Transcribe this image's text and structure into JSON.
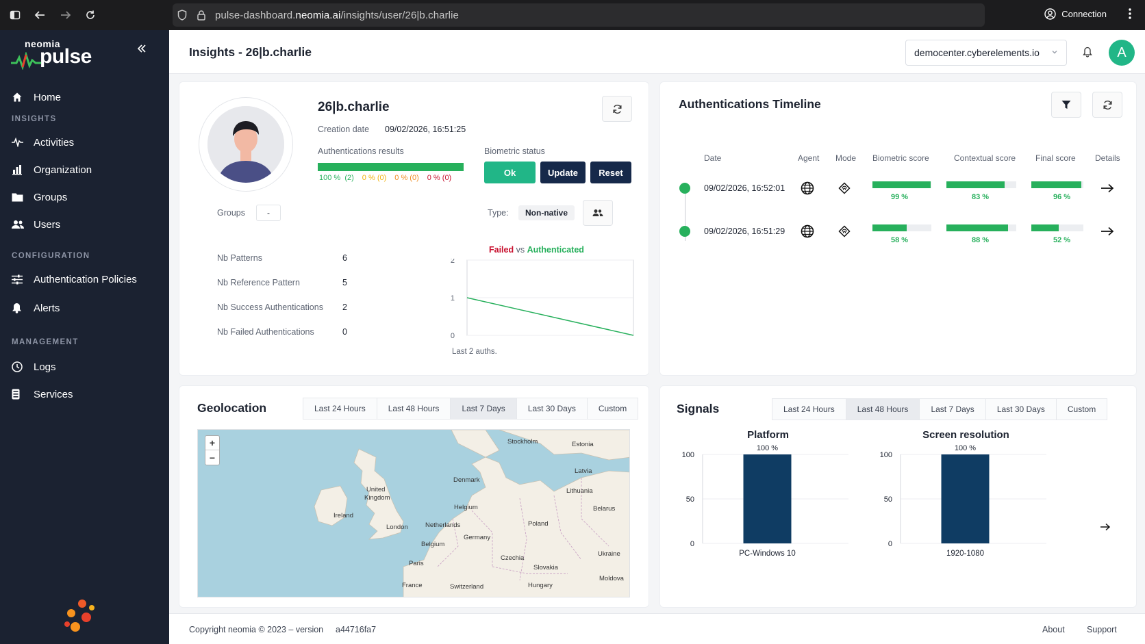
{
  "browser": {
    "url_prefix": "pulse-dashboard.",
    "url_domain": "neomia.ai",
    "url_path": "/insights/user/26|b.charlie",
    "connection_label": "Connection"
  },
  "sidebar": {
    "logo_top": "neomia",
    "logo_main": "pulse",
    "home": "Home",
    "sections": {
      "insights": "INSIGHTS",
      "configuration": "CONFIGURATION",
      "management": "MANAGEMENT"
    },
    "items": {
      "activities": "Activities",
      "organization": "Organization",
      "groups": "Groups",
      "users": "Users",
      "auth_policies": "Authentication Policies",
      "alerts": "Alerts",
      "logs": "Logs",
      "services": "Services"
    }
  },
  "header": {
    "title": "Insights - 26|b.charlie",
    "tenant": "democenter.cyberelements.io",
    "avatar_letter": "A"
  },
  "profile": {
    "name": "26|b.charlie",
    "creation_label": "Creation date",
    "creation_value": "09/02/2026, 16:51:25",
    "auth_results_label": "Authentications results",
    "legend": {
      "success": "100 %",
      "success_count": "(2)",
      "warn1": "0 %",
      "warn1_count": "(0)",
      "warn2": "0 %",
      "warn2_count": "(0)",
      "failed": "0 %",
      "failed_count": "(0)"
    },
    "success_ratio": 1.0,
    "biometric_label": "Biometric status",
    "btn_ok": "Ok",
    "btn_update": "Update",
    "btn_reset": "Reset",
    "groups_label": "Groups",
    "groups_value": "-",
    "type_label": "Type:",
    "type_value": "Non-native",
    "stats": [
      {
        "label": "Nb Patterns",
        "value": "6"
      },
      {
        "label": "Nb Reference Pattern",
        "value": "5"
      },
      {
        "label": "Nb Success Authentications",
        "value": "2"
      },
      {
        "label": "Nb Failed Authentications",
        "value": "0"
      }
    ],
    "chart_title_failed": "Failed",
    "chart_title_vs": " vs ",
    "chart_title_auth": "Authenticated",
    "chart_xlabel": "Last 2 auths.",
    "chart_yticks": [
      "2",
      "1",
      "0"
    ]
  },
  "timeline": {
    "title": "Authentications Timeline",
    "columns": [
      "Date",
      "Agent",
      "Mode",
      "Biometric score",
      "Contextual score",
      "Final score",
      "Details"
    ],
    "rows": [
      {
        "date": "09/02/2026, 16:52:01",
        "biometric": 99,
        "biometric_label": "99 %",
        "contextual": 83,
        "contextual_label": "83 %",
        "final": 96,
        "final_label": "96 %"
      },
      {
        "date": "09/02/2026, 16:51:29",
        "biometric": 58,
        "biometric_label": "58 %",
        "contextual": 88,
        "contextual_label": "88 %",
        "final": 52,
        "final_label": "52 %"
      }
    ]
  },
  "geolocation": {
    "title": "Geolocation",
    "tabs": [
      "Last 24 Hours",
      "Last 48 Hours",
      "Last 7 Days",
      "Last 30 Days",
      "Custom"
    ],
    "active_tab": 2,
    "map_labels": [
      "Stockholm",
      "Estonia",
      "Latvia",
      "Denmark",
      "Lithuania",
      "United",
      "Kingdom",
      "Ireland",
      "Helgium",
      "Belarus",
      "London",
      "Netherlands",
      "Poland",
      "Germany",
      "Belgium",
      "Ukraine",
      "Czechia",
      "Paris",
      "Slovakia",
      "Moldova",
      "France",
      "Switzerland",
      "Hungary"
    ]
  },
  "signals": {
    "title": "Signals",
    "tabs": [
      "Last 24 Hours",
      "Last 48 Hours",
      "Last 7 Days",
      "Last 30 Days",
      "Custom"
    ],
    "active_tab": 1
  },
  "chart_data": [
    {
      "type": "line",
      "title": "Failed vs Authenticated",
      "xlabel": "Last 2 auths.",
      "ylim": [
        0,
        2
      ],
      "yticks": [
        0,
        1,
        2
      ],
      "series": [
        {
          "values": [
            1,
            0
          ]
        }
      ],
      "line_color": "#27b05c"
    },
    {
      "type": "bar",
      "title": "Platform",
      "categories": [
        "PC-Windows 10"
      ],
      "values": [
        100
      ],
      "data_labels": [
        "100 %"
      ],
      "ylim": [
        0,
        100
      ],
      "yticks": [
        0,
        50,
        100
      ],
      "bar_color": "#0f3c63"
    },
    {
      "type": "bar",
      "title": "Screen resolution",
      "categories": [
        "1920-1080"
      ],
      "values": [
        100
      ],
      "data_labels": [
        "100 %"
      ],
      "ylim": [
        0,
        100
      ],
      "yticks": [
        0,
        50,
        100
      ],
      "bar_color": "#0f3c63"
    }
  ],
  "footer": {
    "copyright": "Copyright neomia © 2023 – version",
    "version": "a44716fa7",
    "about": "About",
    "support": "Support"
  },
  "colors": {
    "sidebar_bg": "#1b2231",
    "accent_green": "#27b05c",
    "button_navy": "#16294a",
    "bar_navy": "#0f3c63",
    "avatar_green": "#21b687",
    "failed_red": "#c8102e"
  }
}
